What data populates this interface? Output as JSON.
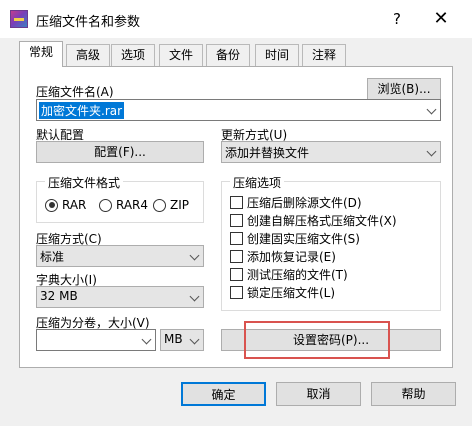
{
  "window": {
    "title": "压缩文件名和参数",
    "help_glyph": "?",
    "close_glyph": "✕"
  },
  "tabs": [
    "常规",
    "高级",
    "选项",
    "文件",
    "备份",
    "时间",
    "注释"
  ],
  "archive_name": {
    "label": "压缩文件名(A)",
    "value": "加密文件夹.rar",
    "browse": "浏览(B)..."
  },
  "default_profile": {
    "label": "默认配置",
    "button": "配置(F)..."
  },
  "update_mode": {
    "label": "更新方式(U)",
    "value": "添加并替换文件"
  },
  "archive_format": {
    "title": "压缩文件格式",
    "options": [
      "RAR",
      "RAR4",
      "ZIP"
    ],
    "selected": "RAR"
  },
  "compression_method": {
    "label": "压缩方式(C)",
    "value": "标准"
  },
  "dictionary_size": {
    "label": "字典大小(I)",
    "value": "32 MB"
  },
  "split_volumes": {
    "label": "压缩为分卷，大小(V)",
    "value": "",
    "unit": "MB"
  },
  "archive_options": {
    "title": "压缩选项",
    "items": [
      "压缩后删除源文件(D)",
      "创建自解压格式压缩文件(X)",
      "创建固实压缩文件(S)",
      "添加恢复记录(E)",
      "测试压缩的文件(T)",
      "锁定压缩文件(L)"
    ]
  },
  "set_password": "设置密码(P)...",
  "footer": {
    "ok": "确定",
    "cancel": "取消",
    "help": "帮助"
  },
  "colors": {
    "highlight": "#d9534f",
    "selection": "#0078d7"
  }
}
